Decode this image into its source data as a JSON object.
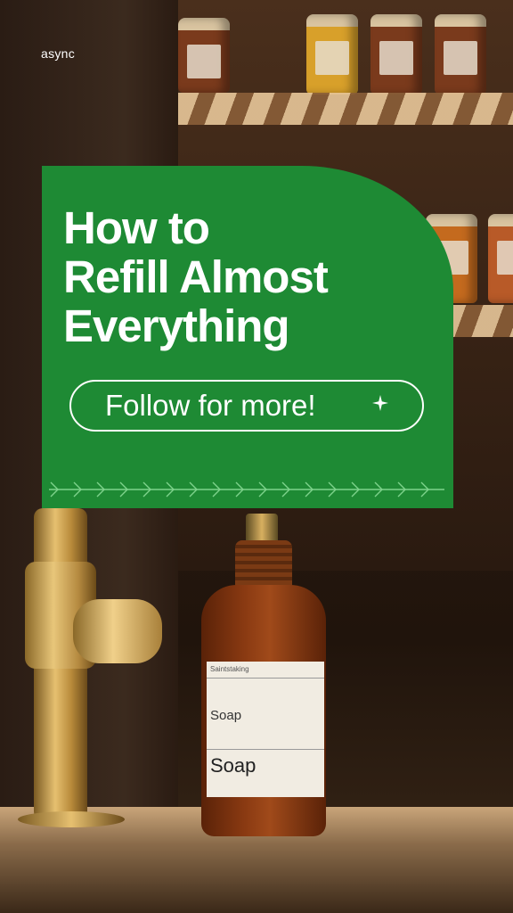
{
  "brand": "async",
  "card": {
    "headline_lines": [
      "How to",
      "Refill Almost",
      "Everything"
    ],
    "cta_label": "Follow for more!",
    "cta_icon": "sparkle-icon"
  },
  "bottle_label": {
    "brand": "Saintstaking",
    "name_small": "Soap",
    "name_large": "Soap"
  },
  "colors": {
    "card_green": "#1e8a34",
    "text": "#ffffff"
  }
}
